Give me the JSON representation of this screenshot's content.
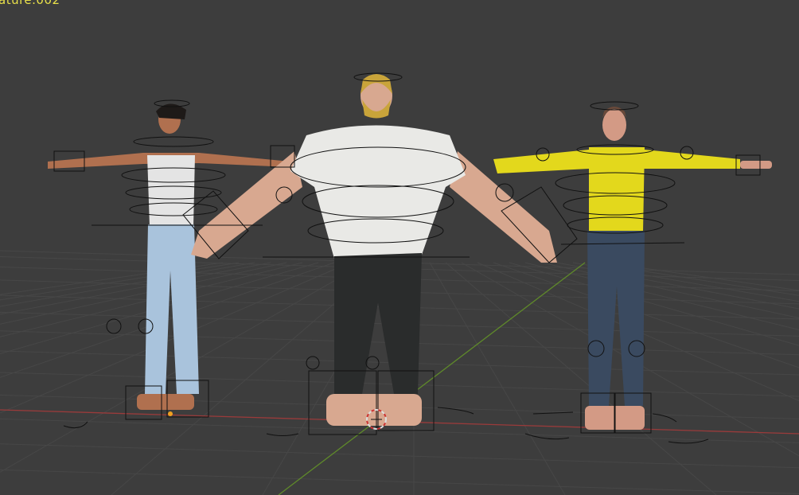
{
  "viewport": {
    "active_object_label": "ature.002",
    "characters": [
      {
        "name": "character-tank-top",
        "shirt": "#e6e6e6",
        "pants": "#a9c3dc",
        "skin": "#b0704f",
        "hair": "#1e1a18"
      },
      {
        "name": "character-large-white-shirt",
        "shirt": "#e9e9e6",
        "pants": "#2a2c2c",
        "skin": "#d8a890",
        "hair": "#c9a43a"
      },
      {
        "name": "character-yellow-sweater",
        "shirt": "#e3d81c",
        "pants": "#3a4a60",
        "skin": "#d39a85",
        "hair": "#6b4a3a"
      }
    ],
    "colors": {
      "background": "#3d3d3d",
      "grid": "#4a4a4a",
      "x_axis": "#9a3b3b",
      "y_axis": "#5f8a2a",
      "label": "#e8e04a"
    }
  }
}
